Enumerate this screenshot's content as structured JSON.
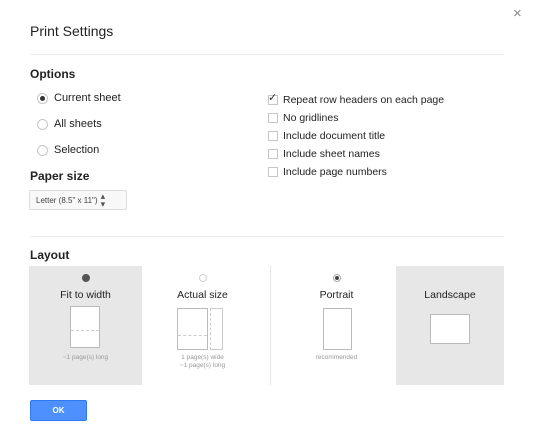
{
  "dialog": {
    "title": "Print Settings",
    "close_glyph": "×"
  },
  "options": {
    "heading": "Options",
    "scope_radios": [
      {
        "label": "Current sheet",
        "checked": true
      },
      {
        "label": "All sheets",
        "checked": false
      },
      {
        "label": "Selection",
        "checked": false
      }
    ],
    "checkboxes": [
      {
        "label": "Repeat row headers on each page",
        "checked": true
      },
      {
        "label": "No gridlines",
        "checked": false
      },
      {
        "label": "Include document title",
        "checked": false
      },
      {
        "label": "Include sheet names",
        "checked": false
      },
      {
        "label": "Include page numbers",
        "checked": false
      }
    ]
  },
  "paper_size": {
    "heading": "Paper size",
    "selected": "Letter (8.5\" x 11\")"
  },
  "layout": {
    "heading": "Layout",
    "fit_to_width": {
      "label": "Fit to width",
      "caption": "~1 page(s) long"
    },
    "actual_size": {
      "label": "Actual size",
      "caption_line1": "1 page(s) wide",
      "caption_line2": "~1 page(s) long"
    },
    "portrait": {
      "label": "Portrait",
      "caption": "recommended"
    },
    "landscape": {
      "label": "Landscape"
    }
  },
  "ok_button": {
    "label": "OK"
  },
  "icons": {
    "close": "close-icon",
    "check": "checkmark-icon",
    "select_arrows": "updown-arrows-icon"
  }
}
